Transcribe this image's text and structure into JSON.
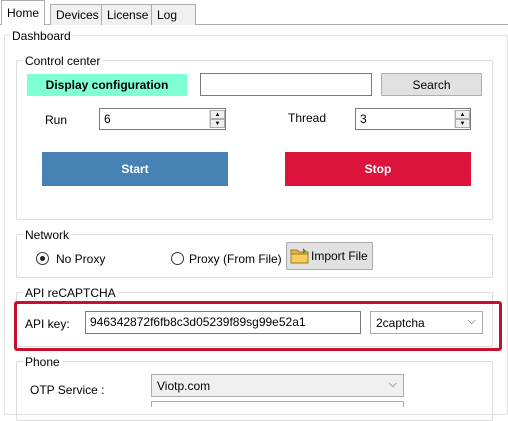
{
  "tabs": [
    {
      "label": "Home"
    },
    {
      "label": "Devices"
    },
    {
      "label": "License"
    },
    {
      "label": "Log"
    }
  ],
  "dashboard": {
    "title": "Dashboard"
  },
  "control_center": {
    "title": "Control center",
    "display_config_label": "Display configuration",
    "search_value": "",
    "search_label": "Search",
    "run_label": "Run",
    "run_value": "6",
    "thread_label": "Thread",
    "thread_value": "3",
    "start_label": "Start",
    "stop_label": "Stop"
  },
  "network": {
    "title": "Network",
    "no_proxy_label": "No Proxy",
    "proxy_file_label": "Proxy (From File)",
    "import_file_label": "Import File",
    "selected": "No Proxy"
  },
  "recaptcha": {
    "title": "API reCAPTCHA",
    "api_key_label": "API key:",
    "api_key_value": "946342872f6fb8c3d05239f89sg99e52a1",
    "provider_value": "2captcha"
  },
  "phone": {
    "title": "Phone",
    "otp_label": "OTP Service :",
    "otp_value": "Viotp.com"
  },
  "colors": {
    "display_config_bg": "#7fffd4",
    "start_bg": "#4682b4",
    "stop_bg": "#dc143c",
    "highlight_border": "#c8102e"
  }
}
